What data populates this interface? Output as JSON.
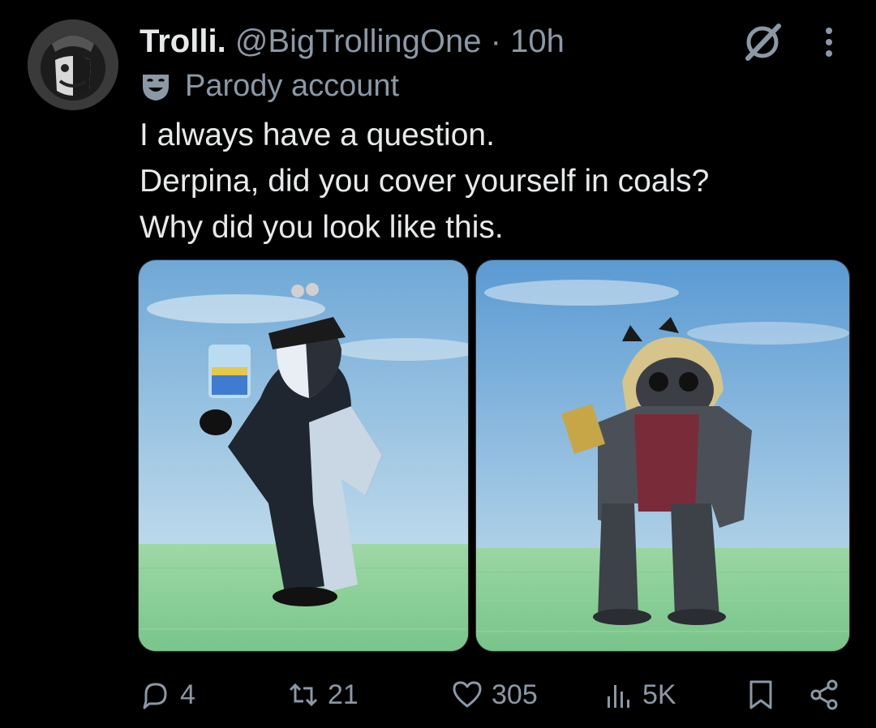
{
  "tweet": {
    "author_name": "Trolli.",
    "author_handle": "@BigTrollingOne",
    "separator": "·",
    "time": "10h",
    "label_text": "Parody account",
    "lines": [
      "I always have a question.",
      "Derpina, did you cover yourself in coals?",
      "Why did you look like this."
    ]
  },
  "actions": {
    "replies": "4",
    "reposts": "21",
    "likes": "305",
    "views": "5K"
  },
  "icons": {
    "avatar": "trollface-avatar",
    "grok": "grok-icon",
    "more": "more-dots-icon",
    "parody": "theater-mask-icon",
    "reply": "reply-icon",
    "repost": "repost-icon",
    "like": "heart-icon",
    "views": "views-icon",
    "bookmark": "bookmark-icon",
    "share": "share-icon"
  },
  "colors": {
    "background": "#000000",
    "text": "#e7e9ea",
    "secondary": "#8b98a5"
  }
}
